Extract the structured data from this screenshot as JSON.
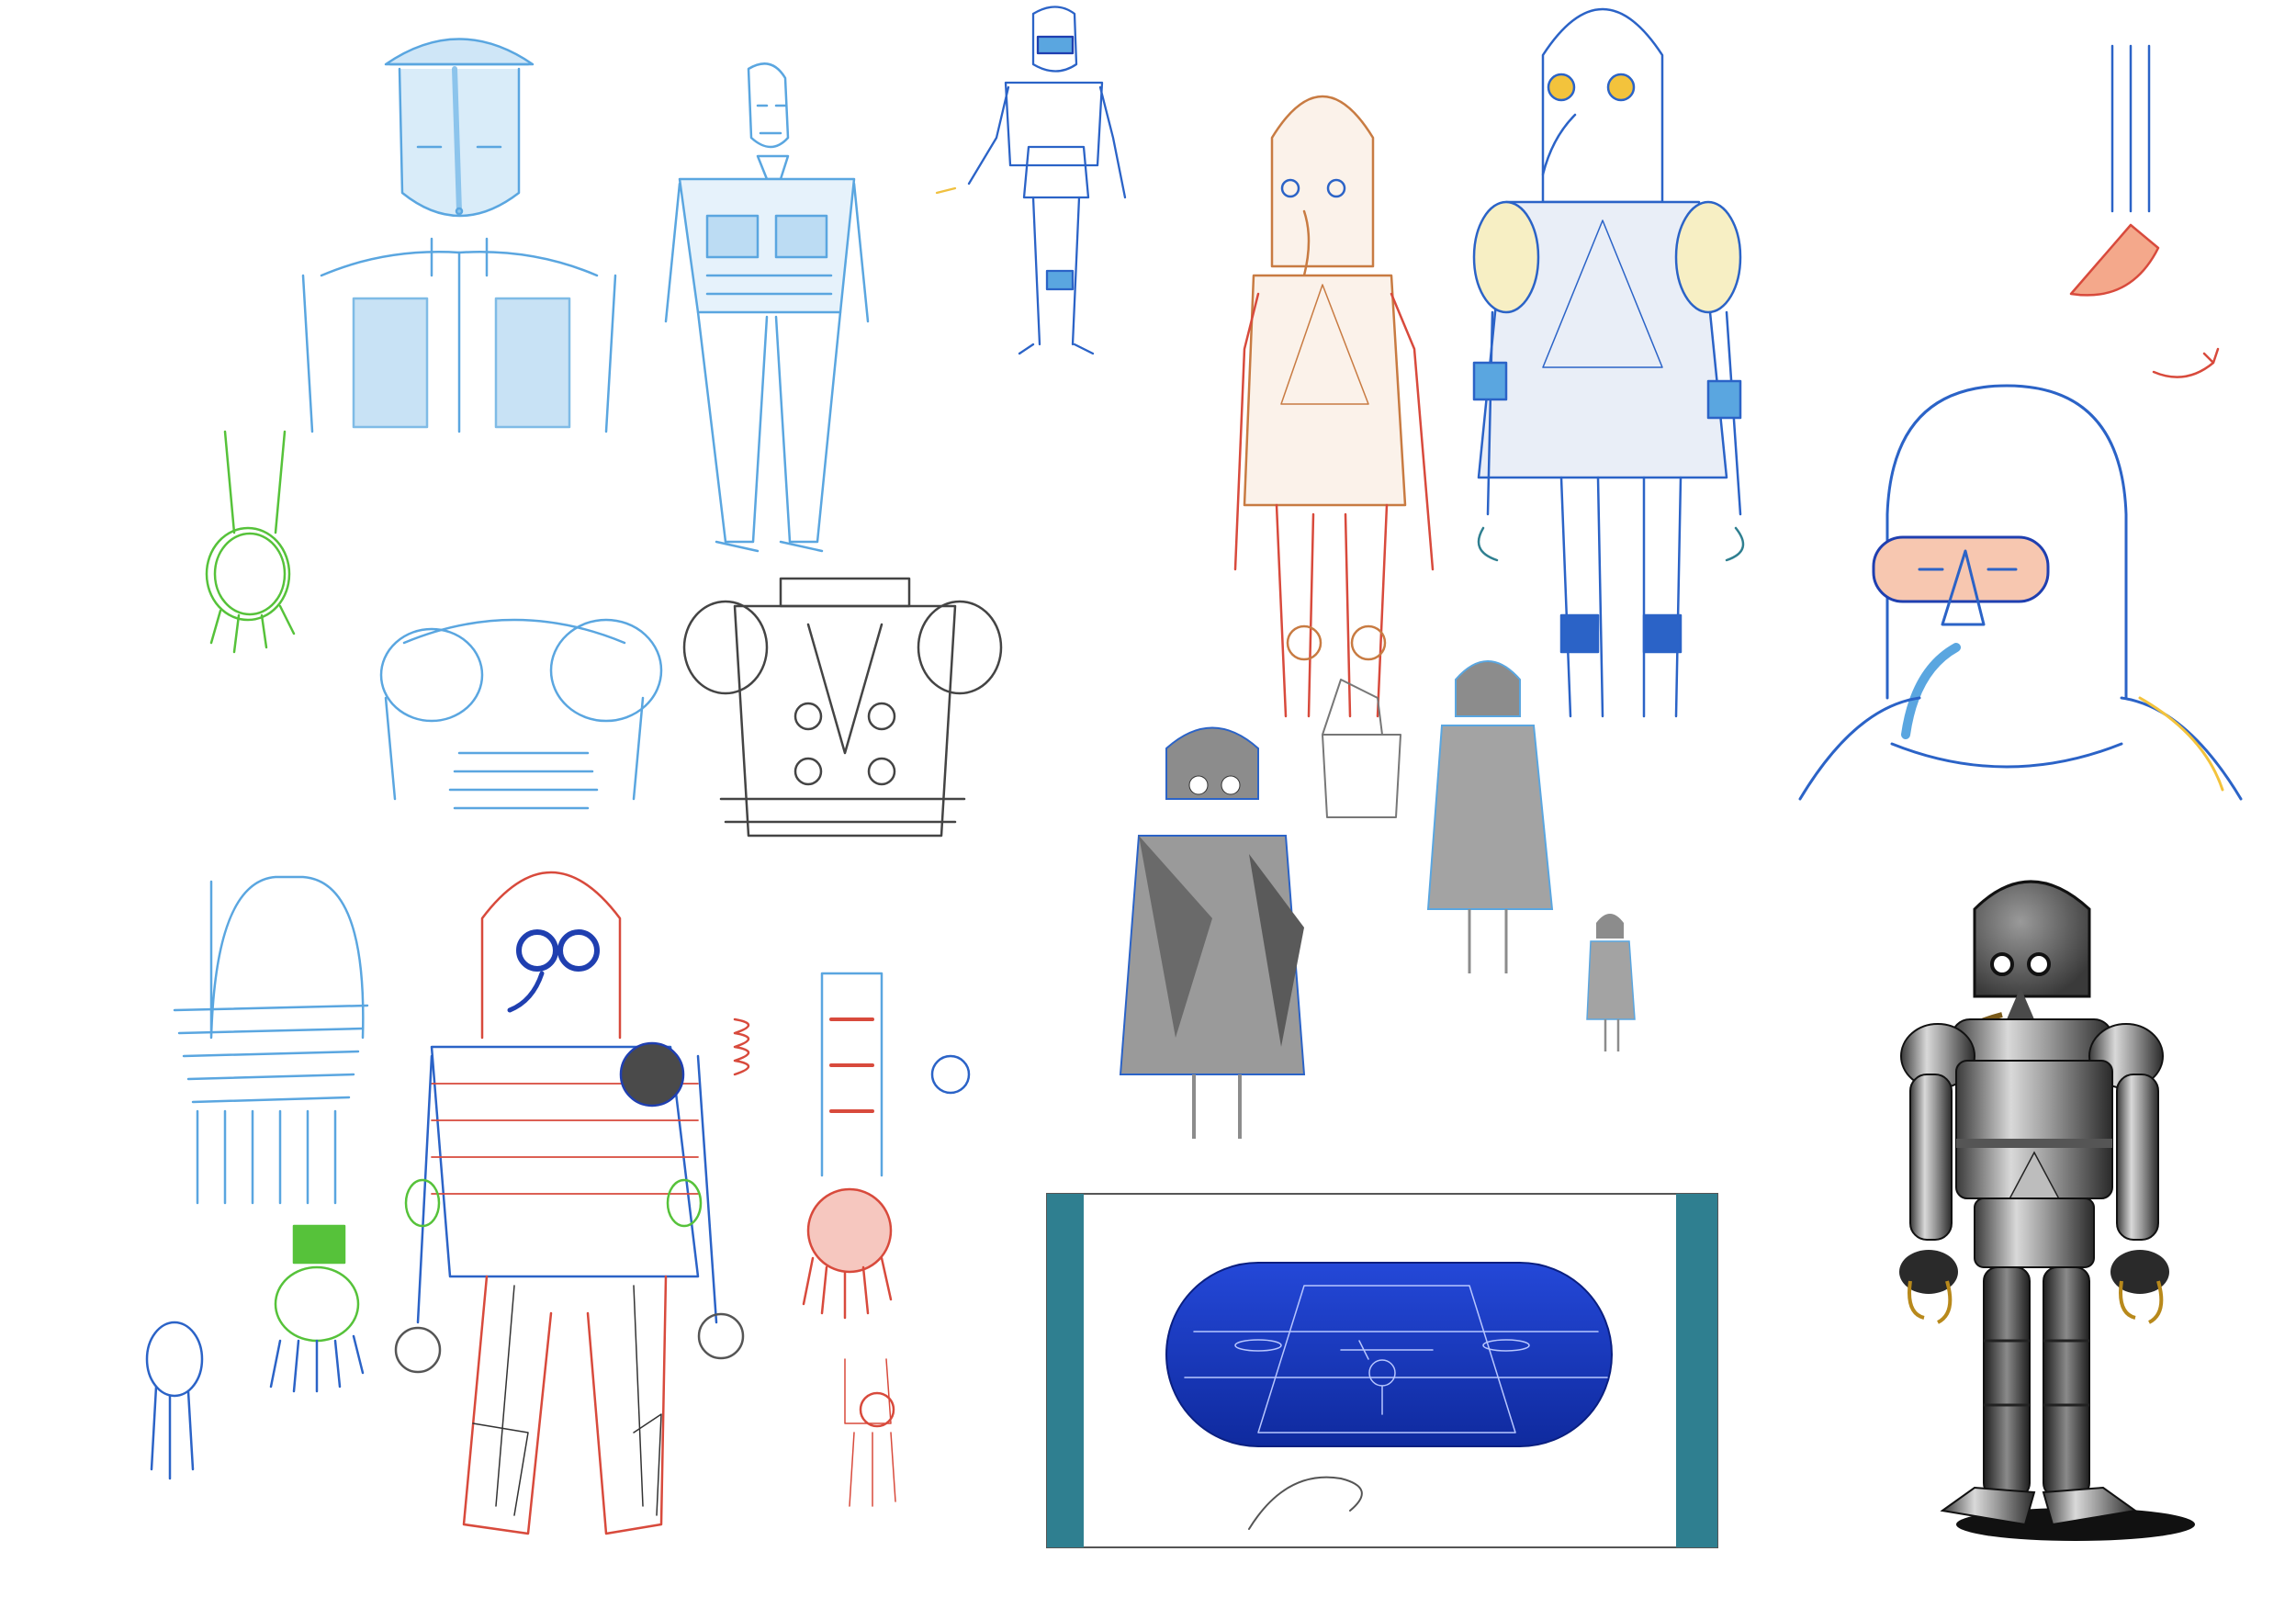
{
  "sheet": {
    "background": "#ffffff",
    "palette": {
      "light_blue": "#5aa6e0",
      "blue": "#2b63c7",
      "deep_blue": "#1f3fb0",
      "orange": "#c87b42",
      "red": "#d84a3c",
      "green": "#56c23a",
      "grey": "#6b6b6b",
      "ink": "#333333",
      "teal": "#2f7f90",
      "pool_blue": "#1e3fcf"
    },
    "panels": [
      {
        "id": "bust-sketch",
        "icon": "robot-bust-sketch"
      },
      {
        "id": "pilot-figure-sketch",
        "icon": "figure-sketch"
      },
      {
        "id": "small-diver-sketch",
        "icon": "diver-figure-sketch"
      },
      {
        "id": "green-hand-sketch",
        "icon": "hand-sketch"
      },
      {
        "id": "armor-torso-sketches",
        "icon": "torso-sketch"
      },
      {
        "id": "orange-diver-sketch",
        "icon": "diver-figure-sketch"
      },
      {
        "id": "blue-diver-sketch",
        "icon": "diver-figure-sketch"
      },
      {
        "id": "arm-rotation-sketch",
        "icon": "rotation-arrow"
      },
      {
        "id": "helmet-closeup-sketch",
        "icon": "helmet-sketch"
      },
      {
        "id": "grey-silhouettes",
        "icon": "silhouette-sketch"
      },
      {
        "id": "basket-hand-sketches",
        "icon": "hand-sketch"
      },
      {
        "id": "colored-diver-sketch",
        "icon": "diver-figure-sketch"
      },
      {
        "id": "arm-details-sketch",
        "icon": "arm-sketch"
      },
      {
        "id": "window-storyboard",
        "icon": "storyboard-frame"
      },
      {
        "id": "diving-suit-photo",
        "icon": "diving-suit-photo"
      }
    ]
  }
}
